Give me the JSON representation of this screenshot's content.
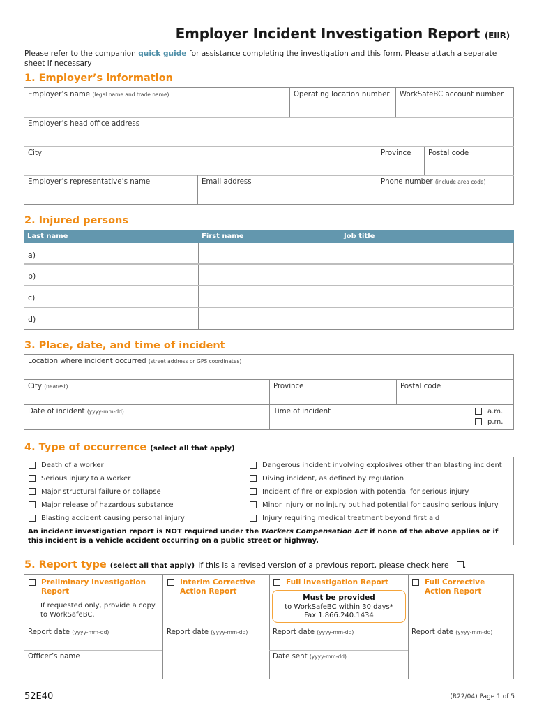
{
  "header": {
    "title": "Employer Incident Investigation Report",
    "title_abbr": "(EIIR)",
    "intro_before": "Please refer to the companion ",
    "intro_link": "quick guide",
    "intro_after": " for assistance completing the investigation and this form. Please attach a separate sheet if necessary"
  },
  "section1": {
    "heading": "1. Employer’s information",
    "employer_name": "Employer’s name",
    "employer_name_hint": "(legal name and trade name)",
    "operating_location": "Operating location number",
    "account_number": "WorkSafeBC account number",
    "head_office": "Employer’s head office address",
    "city": "City",
    "province": "Province",
    "postal_code": "Postal code",
    "rep_name": "Employer’s representative’s name",
    "email": "Email address",
    "phone": "Phone number",
    "phone_hint": "(include area code)"
  },
  "section2": {
    "heading": "2. Injured persons",
    "columns": [
      "Last name",
      "First name",
      "Job title"
    ],
    "rows": [
      "a)",
      "b)",
      "c)",
      "d)"
    ]
  },
  "section3": {
    "heading": "3. Place, date, and time of incident",
    "location": "Location where incident occurred",
    "location_hint": "(street address or GPS coordinates)",
    "city": "City",
    "city_hint": "(nearest)",
    "province": "Province",
    "postal_code": "Postal code",
    "date": "Date of incident",
    "date_hint": "(yyyy-mm-dd)",
    "time": "Time of incident",
    "am": "a.m.",
    "pm": "p.m."
  },
  "section4": {
    "heading": "4. Type of occurrence",
    "heading_hint": "(select all that apply)",
    "left_options": [
      "Death of a worker",
      "Serious injury to a worker",
      "Major structural failure or collapse",
      "Major release of hazardous substance",
      "Blasting accident causing personal injury"
    ],
    "right_options": [
      "Dangerous incident involving explosives other than blasting incident",
      "Diving incident, as defined by regulation",
      "Incident of fire or explosion with potential for serious injury",
      "Minor injury or no injury but had potential for causing serious injury",
      "Injury requiring medical treatment beyond first aid"
    ],
    "note_before": "An incident investigation report is NOT required under the ",
    "note_act": "Workers Compensation Act",
    "note_after": " if none of the above applies or if this incident is a vehicle accident occurring on a public street or highway."
  },
  "section5": {
    "heading": "5. Report type",
    "heading_hint": "(select all that apply)",
    "revised_text": "If this is a revised version of a previous report, please check here",
    "revised_suffix": ".",
    "types": [
      "Preliminary Investigation Report",
      "Interim Corrective Action Report",
      "Full Investigation Report",
      "Full Corrective Action Report"
    ],
    "preliminary_note": "If requested only, provide a copy to WorkSafeBC.",
    "must_title": "Must be provided",
    "must_line1": "to WorkSafeBC within 30 days*",
    "must_line2": "Fax 1.866.240.1434",
    "report_date": "Report date",
    "date_hint": "(yyyy-mm-dd)",
    "officer_name": "Officer’s name",
    "date_sent": "Date sent"
  },
  "footer": {
    "form_code": "52E40",
    "page_info": "(R22/04)  Page 1 of 5"
  }
}
